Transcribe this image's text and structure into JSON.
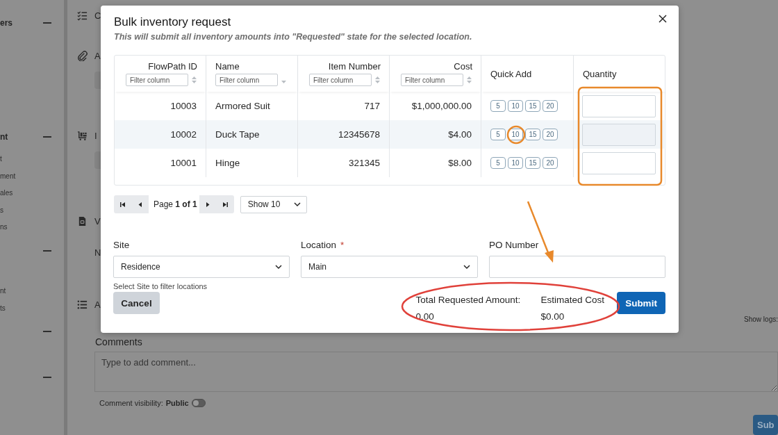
{
  "sidebar": {
    "sections": [
      {
        "label": "ers",
        "expanded": true
      },
      {
        "label": "nt",
        "expanded": true,
        "items": [
          "t",
          "ment",
          "ales",
          "s",
          "ns"
        ]
      },
      {
        "expanded": true,
        "items": [
          "nt",
          "ts"
        ]
      },
      {
        "expanded": true
      },
      {
        "expanded": true
      }
    ]
  },
  "main": {
    "sections": [
      {
        "kind": "checklist",
        "label": "C"
      },
      {
        "kind": "attachment",
        "label": "A",
        "button": true
      },
      {
        "kind": "inventory",
        "label": "I",
        "button": true
      },
      {
        "kind": "document",
        "label": "V"
      },
      {
        "kind": "text",
        "label": "N"
      },
      {
        "kind": "list",
        "label": "A"
      }
    ],
    "show_logs": "Show logs:",
    "comments": {
      "label": "Comments",
      "placeholder": "Type to add comment...",
      "visibility_label": "Comment visibility:",
      "visibility_value": "Public",
      "on": false
    },
    "submit_button": "Sub"
  },
  "dialog": {
    "title": "Bulk inventory request",
    "subtitle": "This will submit all inventory amounts into \"Requested\" state for the selected location.",
    "table": {
      "columns": [
        {
          "label": "FlowPath ID",
          "placeholder": "Filter column",
          "sorted": false
        },
        {
          "label": "Name",
          "placeholder": "Filter column",
          "sorted": true
        },
        {
          "label": "Item Number",
          "placeholder": "Filter column",
          "sorted": false
        },
        {
          "label": "Cost",
          "placeholder": "Filter column",
          "sorted": false
        },
        {
          "label": "Quick Add"
        },
        {
          "label": "Quantity"
        }
      ],
      "rows": [
        {
          "id": "10003",
          "name": "Armored Suit",
          "item_number": "717",
          "cost": "$1,000,000.00",
          "quick_add": [
            "5",
            "10",
            "15",
            "20"
          ],
          "selected": false
        },
        {
          "id": "10002",
          "name": "Duck Tape",
          "item_number": "12345678",
          "cost": "$4.00",
          "quick_add": [
            "5",
            "10",
            "15",
            "20"
          ],
          "selected": true
        },
        {
          "id": "10001",
          "name": "Hinge",
          "item_number": "321345",
          "cost": "$8.00",
          "quick_add": [
            "5",
            "10",
            "15",
            "20"
          ],
          "selected": false
        }
      ]
    },
    "pagination": {
      "page_text": "Page **1 of 1**",
      "page_size": "Show 10"
    },
    "fields": [
      {
        "label": "Site",
        "value": "Residence",
        "kind": "select",
        "helper": "Select Site to filter locations"
      },
      {
        "label": "Location",
        "value": "Main",
        "kind": "select",
        "required_mark": "*"
      },
      {
        "label": "PO Number",
        "kind": "text"
      }
    ],
    "cancel_button": "Cancel",
    "totals": [
      {
        "label": "Total Requested Amount:",
        "value": "0.00"
      },
      {
        "label": "Estimated Cost",
        "value": "$0.00"
      }
    ],
    "submit_button": "Submit"
  },
  "annotations": [
    {
      "kind": "rectangle",
      "color": "#e8892b"
    },
    {
      "kind": "circle",
      "color": "#e8892b"
    },
    {
      "kind": "arrow",
      "color": "#e8892b"
    },
    {
      "kind": "ellipse",
      "color": "#e0413a"
    }
  ]
}
